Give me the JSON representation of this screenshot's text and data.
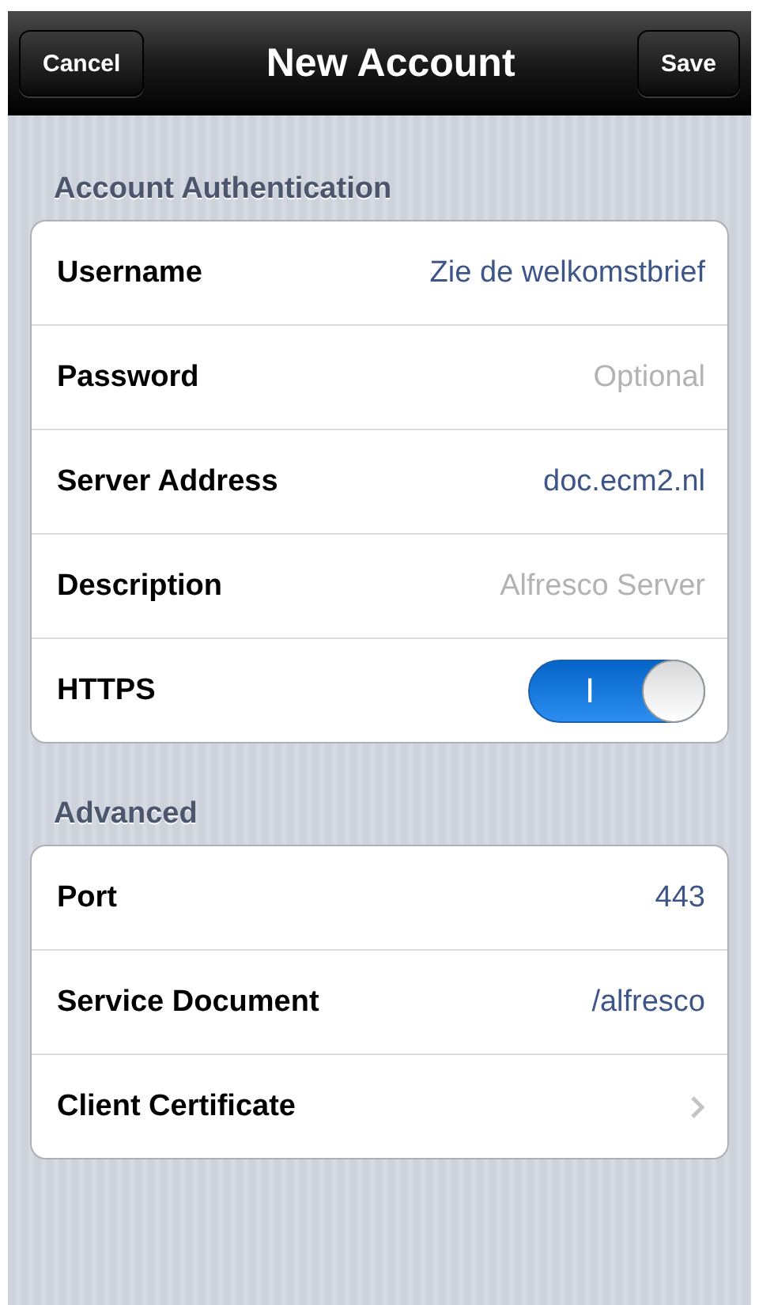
{
  "nav_bar": {
    "title": "New Account",
    "left_button": "Cancel",
    "right_button": "Save"
  },
  "sections": [
    {
      "header": "Account Authentication",
      "rows": [
        {
          "kind": "text",
          "label": "Username",
          "value": "Zie de welkomstbrief"
        },
        {
          "kind": "text",
          "label": "Password",
          "placeholder": "Optional"
        },
        {
          "kind": "text",
          "label": "Server Address",
          "value": "doc.ecm2.nl"
        },
        {
          "kind": "text",
          "label": "Description",
          "placeholder": "Alfresco Server"
        },
        {
          "kind": "switch",
          "label": "HTTPS",
          "on": true,
          "switch_text": "I"
        }
      ]
    },
    {
      "header": "Advanced",
      "rows": [
        {
          "kind": "text",
          "label": "Port",
          "value": "443"
        },
        {
          "kind": "text",
          "label": "Service Document",
          "value": "/alfresco"
        },
        {
          "kind": "disclosure",
          "label": "Client Certificate"
        }
      ]
    }
  ]
}
